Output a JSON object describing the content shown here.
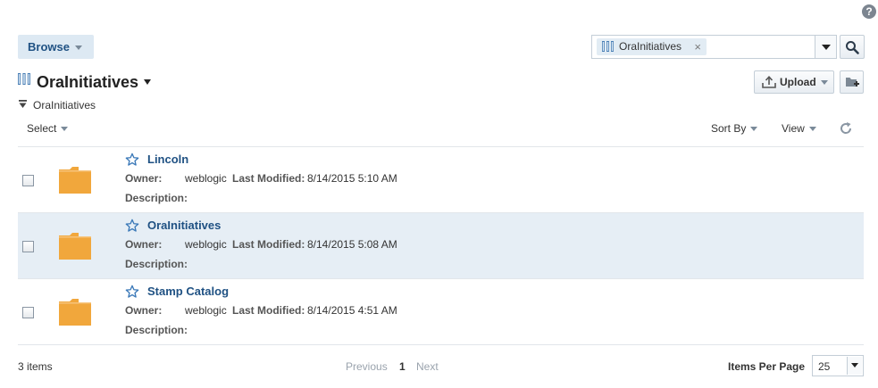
{
  "header": {
    "help_glyph": "?",
    "browse_label": "Browse",
    "search_chip_label": "OraInitiatives",
    "chip_close_glyph": "×"
  },
  "title": {
    "text": "OraInitiatives",
    "upload_label": "Upload"
  },
  "breadcrumb": {
    "text": "OraInitiatives"
  },
  "toolbar": {
    "select_label": "Select",
    "sort_label": "Sort By",
    "view_label": "View"
  },
  "labels": {
    "owner": "Owner:",
    "last_modified": "Last Modified:",
    "description": "Description:"
  },
  "items": [
    {
      "name": "Lincoln",
      "owner": "weblogic",
      "last_modified": "8/14/2015 5:10 AM",
      "description": "",
      "selected": false,
      "highlighted": false
    },
    {
      "name": "OraInitiatives",
      "owner": "weblogic",
      "last_modified": "8/14/2015 5:08 AM",
      "description": "",
      "selected": false,
      "highlighted": true
    },
    {
      "name": "Stamp Catalog",
      "owner": "weblogic",
      "last_modified": "8/14/2015 4:51 AM",
      "description": "",
      "selected": false,
      "highlighted": false
    }
  ],
  "footer": {
    "count_label": "3 items",
    "previous_label": "Previous",
    "current_page": "1",
    "next_label": "Next",
    "items_per_page_label": "Items Per Page",
    "items_per_page_value": "25"
  },
  "colors": {
    "accent": "#1f5183",
    "folder": "#f1a73c",
    "row_highlight": "#e6eef5",
    "library_icon": "#4a7fb5"
  },
  "icons": {
    "help": "help-icon",
    "library": "library-icon",
    "close": "close-icon",
    "search": "search-icon",
    "upload": "upload-icon",
    "new_folder": "new-folder-icon",
    "collapse": "collapse-icon",
    "refresh": "refresh-icon",
    "favorite": "star-icon",
    "folder": "folder-icon"
  }
}
